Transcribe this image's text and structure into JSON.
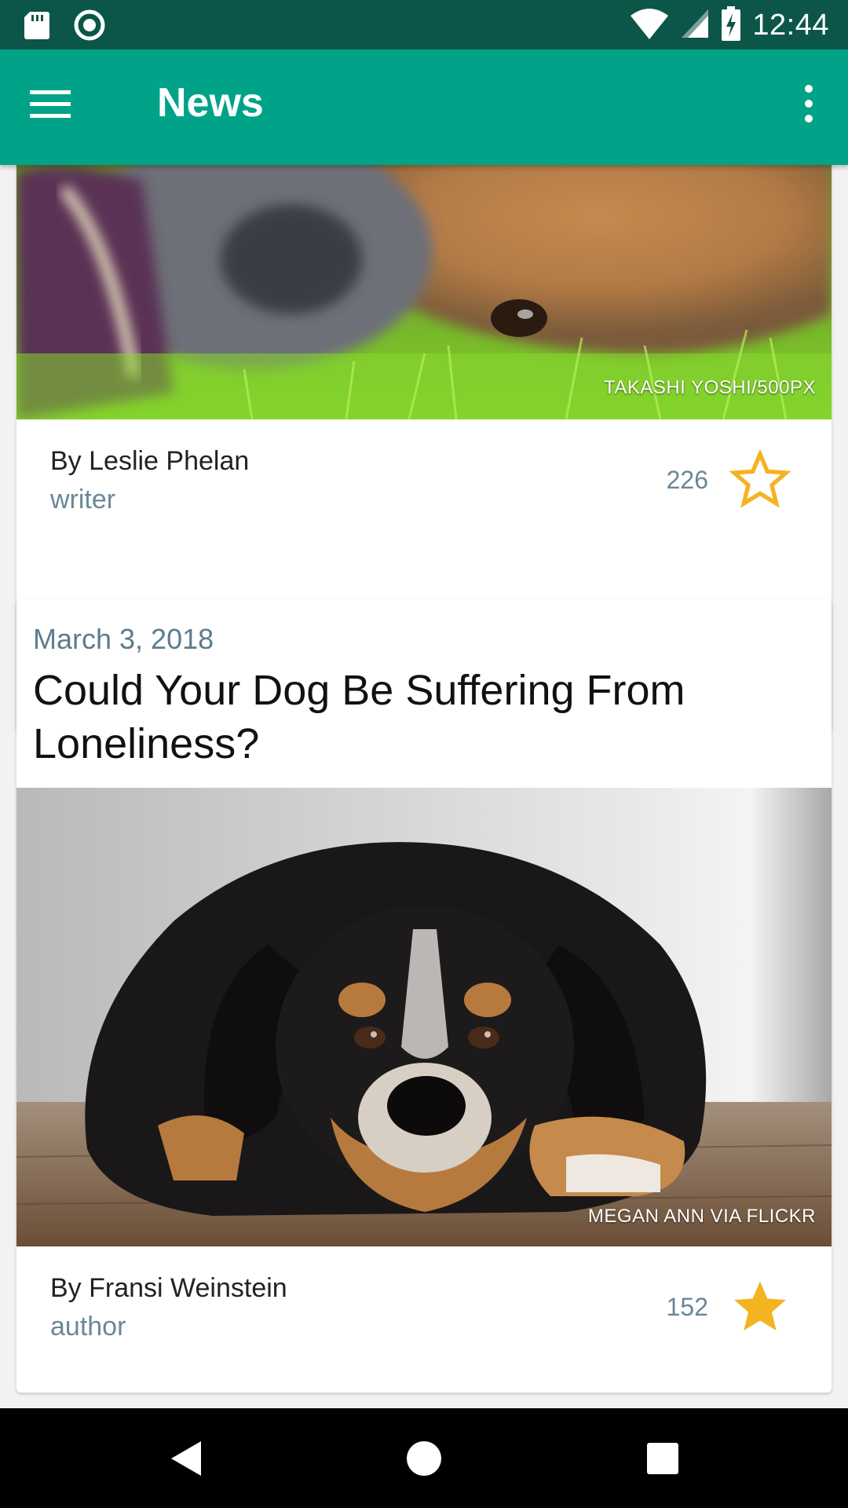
{
  "status_bar": {
    "time": "12:44",
    "icons": [
      "sd-card-icon",
      "sync-circle-icon",
      "wifi-icon",
      "cell-signal-icon",
      "battery-charging-icon"
    ]
  },
  "app_bar": {
    "title": "News",
    "icons": [
      "menu-icon",
      "more-vert-icon"
    ],
    "color": "#00a388"
  },
  "articles": [
    {
      "photo_credit": "TAKASHI YOSHI/500PX",
      "author": "By Leslie Phelan",
      "role": "writer",
      "count": "226",
      "starred": false
    },
    {
      "date": "March 3, 2018",
      "title": "Could Your Dog Be Suffering From Loneliness?",
      "photo_credit": "MEGAN ANN VIA FLICKR",
      "author": "By Fransi Weinstein",
      "role": "author",
      "count": "152",
      "starred": true
    }
  ],
  "nav_bar": {
    "icons": [
      "back-triangle-icon",
      "home-circle-icon",
      "recents-square-icon"
    ]
  },
  "colors": {
    "star": "#f4b321",
    "secondary_text": "#6b8797",
    "status_bar": "#0b5649"
  }
}
